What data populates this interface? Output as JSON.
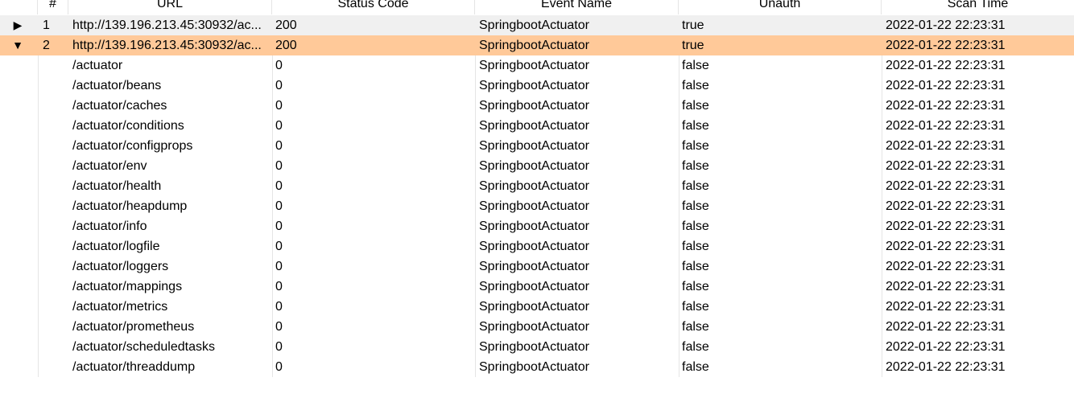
{
  "columns": [
    "#",
    "URL",
    "Status Code",
    "Event Name",
    "Unauth",
    "Scan Time"
  ],
  "parents": [
    {
      "expander": "▶",
      "num": "1",
      "url": "http://139.196.213.45:30932/ac...",
      "status": "200",
      "event": "SpringbootActuator",
      "unauth": "true",
      "time": "2022-01-22 22:23:31"
    },
    {
      "expander": "▼",
      "num": "2",
      "url": "http://139.196.213.45:30932/ac...",
      "status": "200",
      "event": "SpringbootActuator",
      "unauth": "true",
      "time": "2022-01-22 22:23:31"
    }
  ],
  "children": [
    {
      "url": "/actuator",
      "status": "0",
      "event": "SpringbootActuator",
      "unauth": "false",
      "time": "2022-01-22 22:23:31"
    },
    {
      "url": "/actuator/beans",
      "status": "0",
      "event": "SpringbootActuator",
      "unauth": "false",
      "time": "2022-01-22 22:23:31"
    },
    {
      "url": "/actuator/caches",
      "status": "0",
      "event": "SpringbootActuator",
      "unauth": "false",
      "time": "2022-01-22 22:23:31"
    },
    {
      "url": "/actuator/conditions",
      "status": "0",
      "event": "SpringbootActuator",
      "unauth": "false",
      "time": "2022-01-22 22:23:31"
    },
    {
      "url": "/actuator/configprops",
      "status": "0",
      "event": "SpringbootActuator",
      "unauth": "false",
      "time": "2022-01-22 22:23:31"
    },
    {
      "url": "/actuator/env",
      "status": "0",
      "event": "SpringbootActuator",
      "unauth": "false",
      "time": "2022-01-22 22:23:31"
    },
    {
      "url": "/actuator/health",
      "status": "0",
      "event": "SpringbootActuator",
      "unauth": "false",
      "time": "2022-01-22 22:23:31"
    },
    {
      "url": "/actuator/heapdump",
      "status": "0",
      "event": "SpringbootActuator",
      "unauth": "false",
      "time": "2022-01-22 22:23:31"
    },
    {
      "url": "/actuator/info",
      "status": "0",
      "event": "SpringbootActuator",
      "unauth": "false",
      "time": "2022-01-22 22:23:31"
    },
    {
      "url": "/actuator/logfile",
      "status": "0",
      "event": "SpringbootActuator",
      "unauth": "false",
      "time": "2022-01-22 22:23:31"
    },
    {
      "url": "/actuator/loggers",
      "status": "0",
      "event": "SpringbootActuator",
      "unauth": "false",
      "time": "2022-01-22 22:23:31"
    },
    {
      "url": "/actuator/mappings",
      "status": "0",
      "event": "SpringbootActuator",
      "unauth": "false",
      "time": "2022-01-22 22:23:31"
    },
    {
      "url": "/actuator/metrics",
      "status": "0",
      "event": "SpringbootActuator",
      "unauth": "false",
      "time": "2022-01-22 22:23:31"
    },
    {
      "url": "/actuator/prometheus",
      "status": "0",
      "event": "SpringbootActuator",
      "unauth": "false",
      "time": "2022-01-22 22:23:31"
    },
    {
      "url": "/actuator/scheduledtasks",
      "status": "0",
      "event": "SpringbootActuator",
      "unauth": "false",
      "time": "2022-01-22 22:23:31"
    },
    {
      "url": "/actuator/threaddump",
      "status": "0",
      "event": "SpringbootActuator",
      "unauth": "false",
      "time": "2022-01-22 22:23:31"
    }
  ],
  "colors": {
    "selected_row": "#ffc999",
    "parent_row": "#f0f0f0",
    "grid_line": "#e5e5e5"
  }
}
